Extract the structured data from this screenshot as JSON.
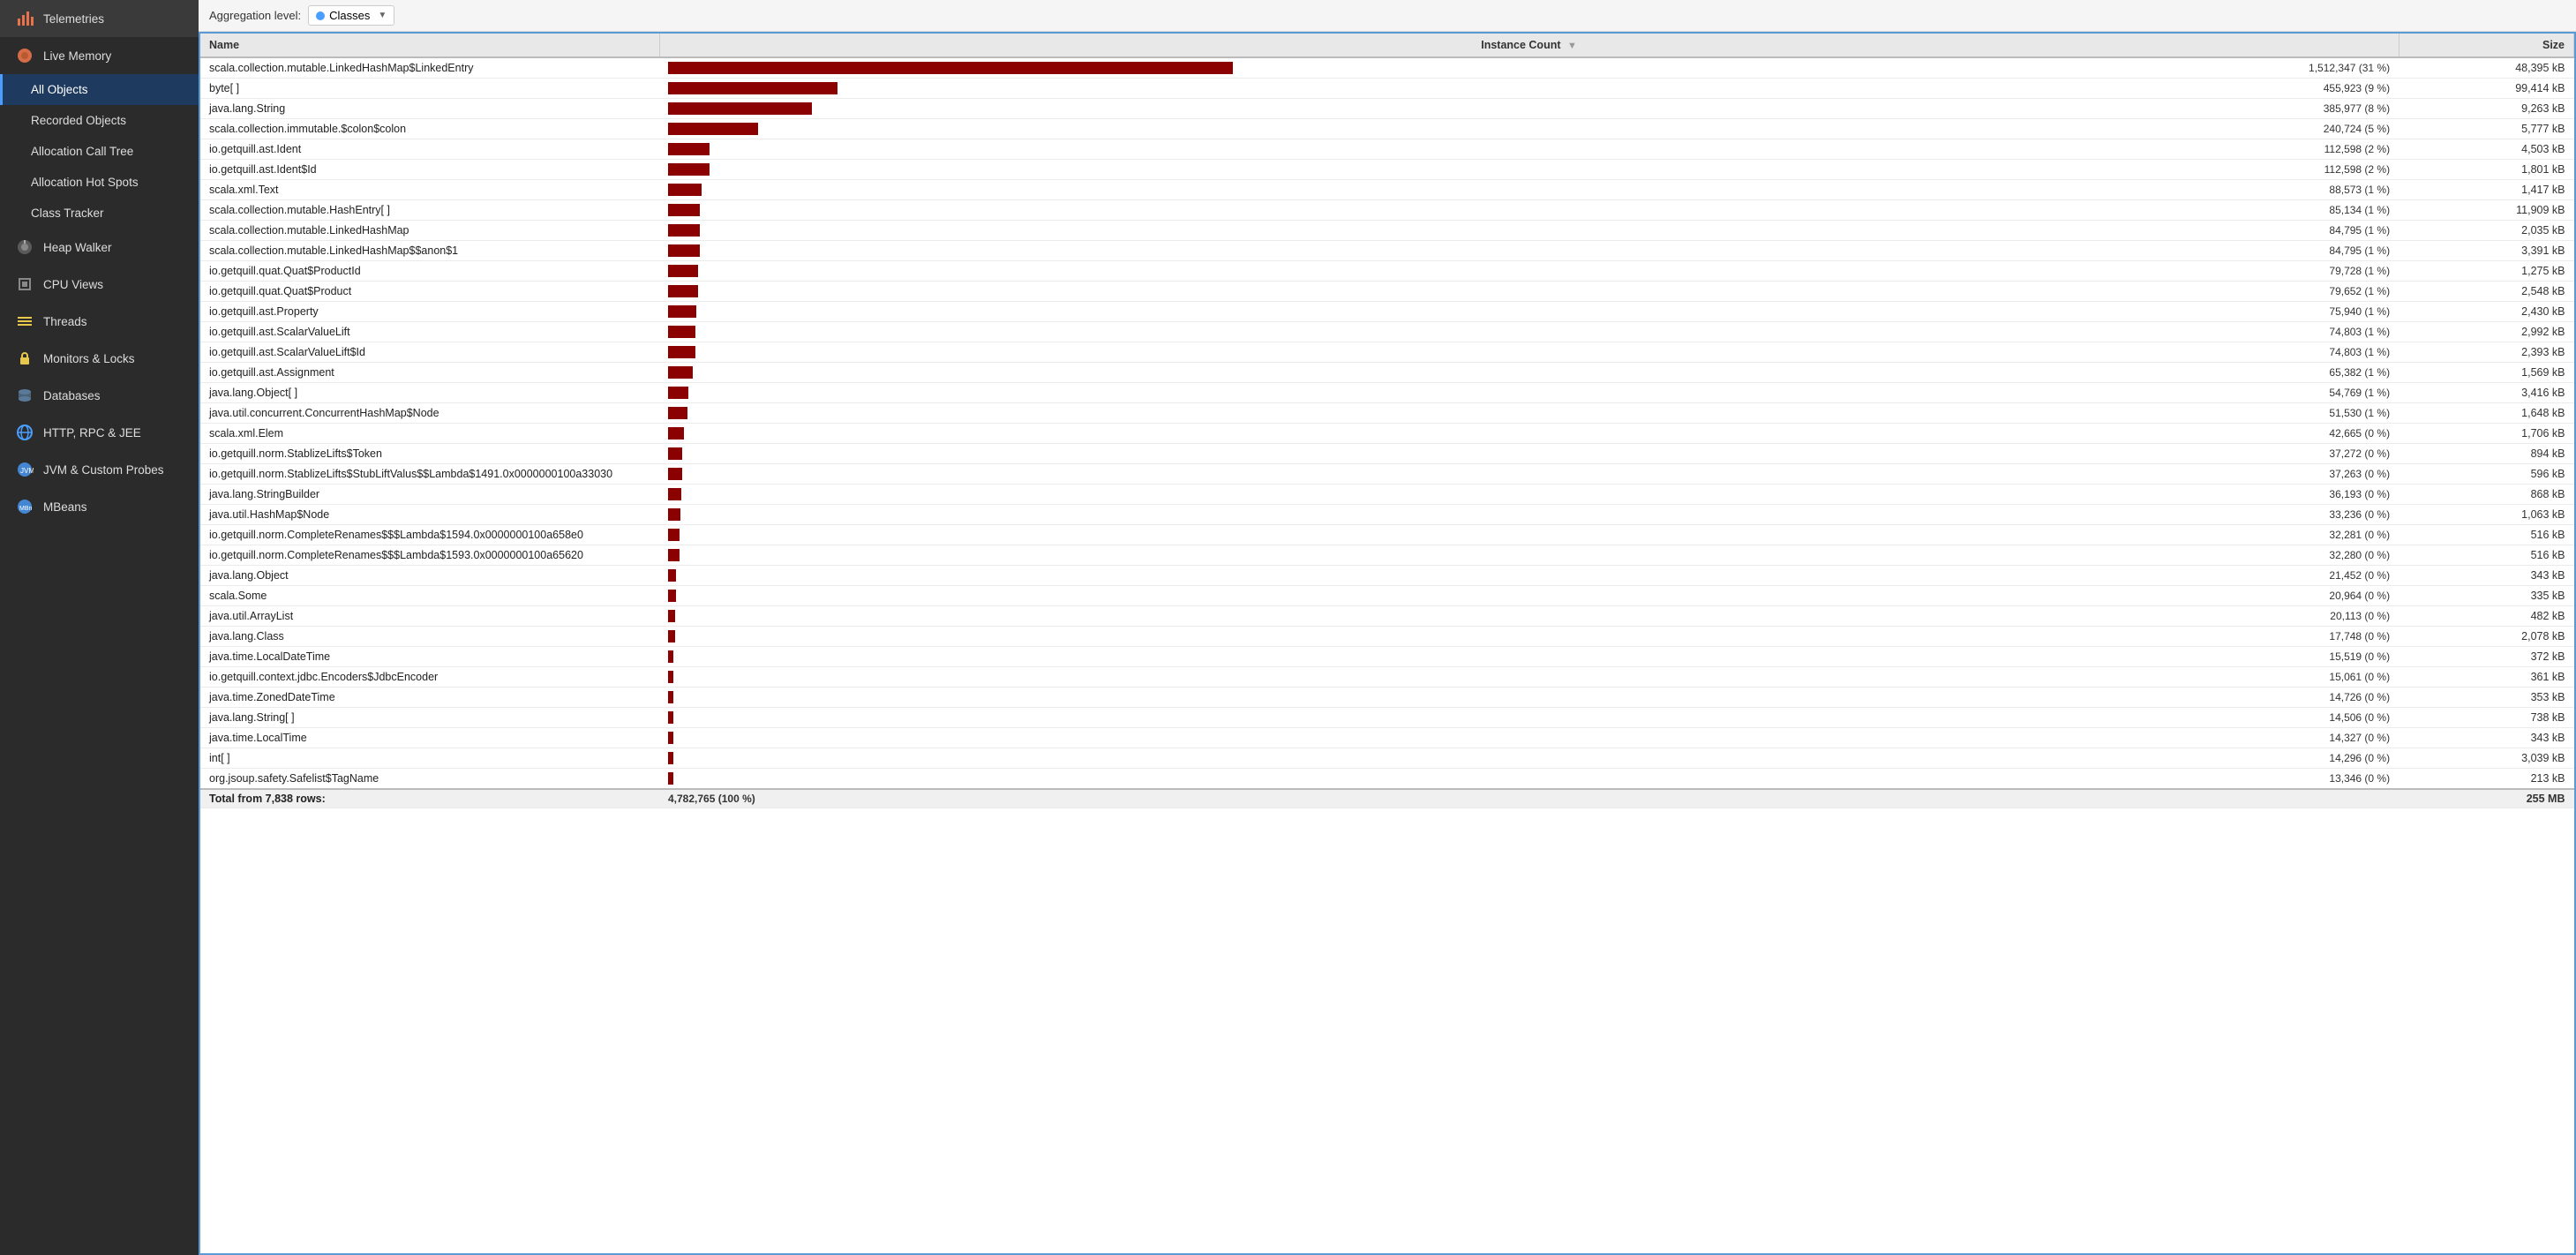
{
  "sidebar": {
    "items": [
      {
        "id": "telemetries",
        "label": "Telemetries",
        "icon": "chart-icon",
        "active": false
      },
      {
        "id": "live-memory",
        "label": "Live Memory",
        "icon": "memory-icon",
        "active": false,
        "expanded": true
      },
      {
        "id": "all-objects",
        "label": "All Objects",
        "icon": "",
        "active": true,
        "sub": true
      },
      {
        "id": "recorded-objects",
        "label": "Recorded Objects",
        "icon": "",
        "active": false,
        "sub": true
      },
      {
        "id": "allocation-call-tree",
        "label": "Allocation Call Tree",
        "icon": "",
        "active": false,
        "sub": true
      },
      {
        "id": "allocation-hot-spots",
        "label": "Allocation Hot Spots",
        "icon": "",
        "active": false,
        "sub": true
      },
      {
        "id": "class-tracker",
        "label": "Class Tracker",
        "icon": "",
        "active": false,
        "sub": true
      },
      {
        "id": "heap-walker",
        "label": "Heap Walker",
        "icon": "heap-icon",
        "active": false
      },
      {
        "id": "cpu-views",
        "label": "CPU Views",
        "icon": "cpu-icon",
        "active": false
      },
      {
        "id": "threads",
        "label": "Threads",
        "icon": "threads-icon",
        "active": false
      },
      {
        "id": "monitors-locks",
        "label": "Monitors & Locks",
        "icon": "lock-icon",
        "active": false
      },
      {
        "id": "databases",
        "label": "Databases",
        "icon": "db-icon",
        "active": false
      },
      {
        "id": "http-rpc-jee",
        "label": "HTTP, RPC & JEE",
        "icon": "globe-icon",
        "active": false
      },
      {
        "id": "jvm-custom-probes",
        "label": "JVM & Custom Probes",
        "icon": "jvm-icon",
        "active": false
      },
      {
        "id": "mbeans",
        "label": "MBeans",
        "icon": "mbeans-icon",
        "active": false
      }
    ]
  },
  "aggregation": {
    "label": "Aggregation level:",
    "value": "Classes",
    "dropdown_label": "Classes"
  },
  "table": {
    "columns": [
      "Name",
      "Instance Count",
      "Size"
    ],
    "rows": [
      {
        "name": "scala.collection.mutable.LinkedHashMap$LinkedEntry",
        "count_raw": 1512347,
        "count_label": "1,512,347 (31 %)",
        "bar_pct": 100,
        "size": "48,395 kB"
      },
      {
        "name": "byte[ ]",
        "count_raw": 455923,
        "count_label": "455,923 (9 %)",
        "bar_pct": 30,
        "size": "99,414 kB"
      },
      {
        "name": "java.lang.String",
        "count_raw": 385977,
        "count_label": "385,977 (8 %)",
        "bar_pct": 25.5,
        "size": "9,263 kB"
      },
      {
        "name": "scala.collection.immutable.$colon$colon",
        "count_raw": 240724,
        "count_label": "240,724 (5 %)",
        "bar_pct": 15.9,
        "size": "5,777 kB"
      },
      {
        "name": "io.getquill.ast.Ident",
        "count_raw": 112598,
        "count_label": "112,598 (2 %)",
        "bar_pct": 7.4,
        "size": "4,503 kB"
      },
      {
        "name": "io.getquill.ast.Ident$Id",
        "count_raw": 112598,
        "count_label": "112,598 (2 %)",
        "bar_pct": 7.4,
        "size": "1,801 kB"
      },
      {
        "name": "scala.xml.Text",
        "count_raw": 88573,
        "count_label": "88,573 (1 %)",
        "bar_pct": 5.9,
        "size": "1,417 kB"
      },
      {
        "name": "scala.collection.mutable.HashEntry[ ]",
        "count_raw": 85134,
        "count_label": "85,134 (1 %)",
        "bar_pct": 5.6,
        "size": "11,909 kB"
      },
      {
        "name": "scala.collection.mutable.LinkedHashMap",
        "count_raw": 84795,
        "count_label": "84,795 (1 %)",
        "bar_pct": 5.6,
        "size": "2,035 kB"
      },
      {
        "name": "scala.collection.mutable.LinkedHashMap$$anon$1",
        "count_raw": 84795,
        "count_label": "84,795 (1 %)",
        "bar_pct": 5.6,
        "size": "3,391 kB"
      },
      {
        "name": "io.getquill.quat.Quat$ProductId",
        "count_raw": 79728,
        "count_label": "79,728 (1 %)",
        "bar_pct": 5.3,
        "size": "1,275 kB"
      },
      {
        "name": "io.getquill.quat.Quat$Product",
        "count_raw": 79652,
        "count_label": "79,652 (1 %)",
        "bar_pct": 5.3,
        "size": "2,548 kB"
      },
      {
        "name": "io.getquill.ast.Property",
        "count_raw": 75940,
        "count_label": "75,940 (1 %)",
        "bar_pct": 5.0,
        "size": "2,430 kB"
      },
      {
        "name": "io.getquill.ast.ScalarValueLift",
        "count_raw": 74803,
        "count_label": "74,803 (1 %)",
        "bar_pct": 4.9,
        "size": "2,992 kB"
      },
      {
        "name": "io.getquill.ast.ScalarValueLift$Id",
        "count_raw": 74803,
        "count_label": "74,803 (1 %)",
        "bar_pct": 4.9,
        "size": "2,393 kB"
      },
      {
        "name": "io.getquill.ast.Assignment",
        "count_raw": 65382,
        "count_label": "65,382 (1 %)",
        "bar_pct": 4.3,
        "size": "1,569 kB"
      },
      {
        "name": "java.lang.Object[ ]",
        "count_raw": 54769,
        "count_label": "54,769 (1 %)",
        "bar_pct": 3.6,
        "size": "3,416 kB"
      },
      {
        "name": "java.util.concurrent.ConcurrentHashMap$Node",
        "count_raw": 51530,
        "count_label": "51,530 (1 %)",
        "bar_pct": 3.4,
        "size": "1,648 kB"
      },
      {
        "name": "scala.xml.Elem",
        "count_raw": 42665,
        "count_label": "42,665 (0 %)",
        "bar_pct": 2.8,
        "size": "1,706 kB"
      },
      {
        "name": "io.getquill.norm.StablizeLifts$Token",
        "count_raw": 37272,
        "count_label": "37,272 (0 %)",
        "bar_pct": 2.5,
        "size": "894 kB"
      },
      {
        "name": "io.getquill.norm.StablizeLifts$StubLiftValus$$Lambda$1491.0x0000000100a33030",
        "count_raw": 37263,
        "count_label": "37,263 (0 %)",
        "bar_pct": 2.5,
        "size": "596 kB"
      },
      {
        "name": "java.lang.StringBuilder",
        "count_raw": 36193,
        "count_label": "36,193 (0 %)",
        "bar_pct": 2.4,
        "size": "868 kB"
      },
      {
        "name": "java.util.HashMap$Node",
        "count_raw": 33236,
        "count_label": "33,236 (0 %)",
        "bar_pct": 2.2,
        "size": "1,063 kB"
      },
      {
        "name": "io.getquill.norm.CompleteRenames$$$Lambda$1594.0x0000000100a658e0",
        "count_raw": 32281,
        "count_label": "32,281 (0 %)",
        "bar_pct": 2.1,
        "size": "516 kB"
      },
      {
        "name": "io.getquill.norm.CompleteRenames$$$Lambda$1593.0x0000000100a65620",
        "count_raw": 32280,
        "count_label": "32,280 (0 %)",
        "bar_pct": 2.1,
        "size": "516 kB"
      },
      {
        "name": "java.lang.Object",
        "count_raw": 21452,
        "count_label": "21,452 (0 %)",
        "bar_pct": 1.4,
        "size": "343 kB"
      },
      {
        "name": "scala.Some",
        "count_raw": 20964,
        "count_label": "20,964 (0 %)",
        "bar_pct": 1.4,
        "size": "335 kB"
      },
      {
        "name": "java.util.ArrayList",
        "count_raw": 20113,
        "count_label": "20,113 (0 %)",
        "bar_pct": 1.3,
        "size": "482 kB"
      },
      {
        "name": "java.lang.Class",
        "count_raw": 17748,
        "count_label": "17,748 (0 %)",
        "bar_pct": 1.2,
        "size": "2,078 kB"
      },
      {
        "name": "java.time.LocalDateTime",
        "count_raw": 15519,
        "count_label": "15,519 (0 %)",
        "bar_pct": 1.0,
        "size": "372 kB"
      },
      {
        "name": "io.getquill.context.jdbc.Encoders$JdbcEncoder",
        "count_raw": 15061,
        "count_label": "15,061 (0 %)",
        "bar_pct": 1.0,
        "size": "361 kB"
      },
      {
        "name": "java.time.ZonedDateTime",
        "count_raw": 14726,
        "count_label": "14,726 (0 %)",
        "bar_pct": 0.97,
        "size": "353 kB"
      },
      {
        "name": "java.lang.String[ ]",
        "count_raw": 14506,
        "count_label": "14,506 (0 %)",
        "bar_pct": 0.96,
        "size": "738 kB"
      },
      {
        "name": "java.time.LocalTime",
        "count_raw": 14327,
        "count_label": "14,327 (0 %)",
        "bar_pct": 0.95,
        "size": "343 kB"
      },
      {
        "name": "int[ ]",
        "count_raw": 14296,
        "count_label": "14,296 (0 %)",
        "bar_pct": 0.95,
        "size": "3,039 kB"
      },
      {
        "name": "org.jsoup.safety.Safelist$TagName",
        "count_raw": 13346,
        "count_label": "13,346 (0 %)",
        "bar_pct": 0.88,
        "size": "213 kB"
      }
    ],
    "total": {
      "label": "Total from 7,838 rows:",
      "count": "4,782,765 (100 %)",
      "size": "255 MB"
    }
  }
}
